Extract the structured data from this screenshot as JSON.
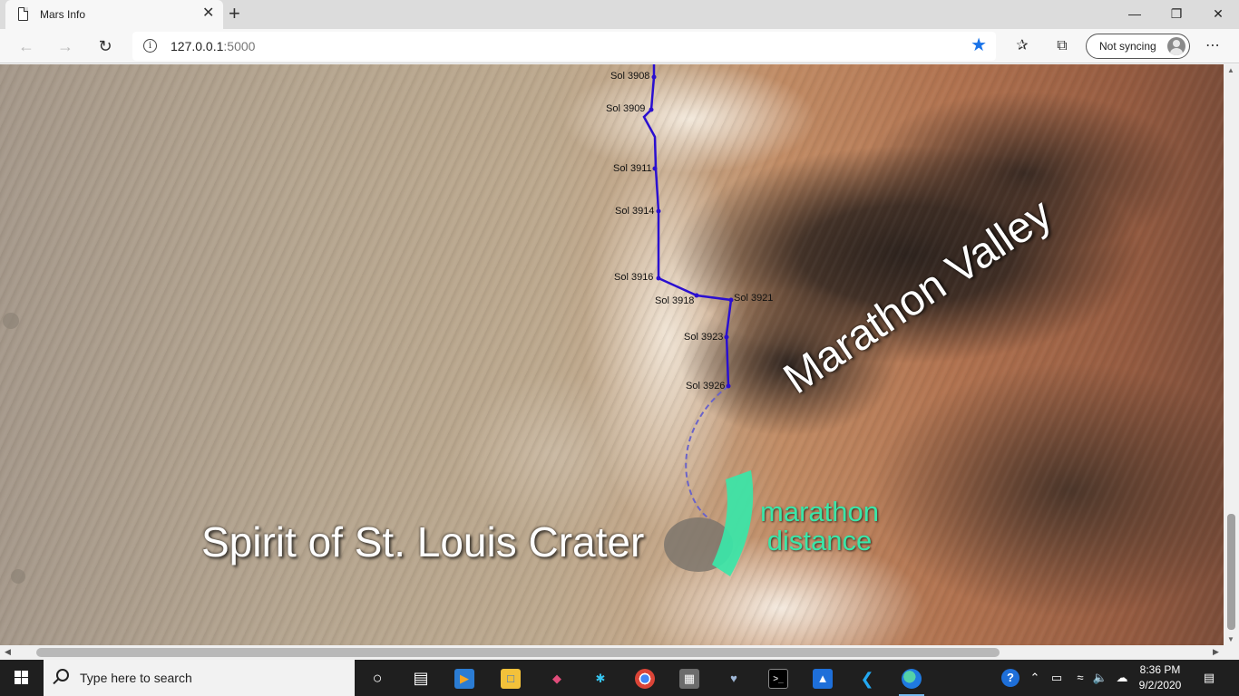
{
  "browser": {
    "tab_title": "Mars Info",
    "tab_close": "✕",
    "new_tab": "+",
    "url_host": "127.0.0.1",
    "url_port": ":5000",
    "sync_label": "Not syncing",
    "window_controls": {
      "minimize": "—",
      "restore": "❐",
      "close": "✕"
    }
  },
  "map": {
    "crater_label": "Spirit of St. Louis Crater",
    "valley_label": "Marathon Valley",
    "marathon_label_line1": "marathon",
    "marathon_label_line2": "distance",
    "sols": [
      {
        "label": "Sol 3908"
      },
      {
        "label": "Sol 3909"
      },
      {
        "label": "Sol 3911"
      },
      {
        "label": "Sol 3914"
      },
      {
        "label": "Sol 3916"
      },
      {
        "label": "Sol 3918"
      },
      {
        "label": "Sol 3921"
      },
      {
        "label": "Sol 3923"
      },
      {
        "label": "Sol 3926"
      }
    ],
    "colors": {
      "traverse": "#2a0fd0",
      "marathon": "#3ae6a8",
      "planned_path": "#6a63c9"
    }
  },
  "taskbar": {
    "search_placeholder": "Type here to search",
    "time": "8:36 PM",
    "date": "9/2/2020",
    "apps": [
      "task-view",
      "file-explorer",
      "media-app",
      "folder",
      "git-app",
      "slack",
      "chrome",
      "calculator",
      "pgadmin",
      "terminal",
      "photos",
      "vscode",
      "edge"
    ]
  }
}
